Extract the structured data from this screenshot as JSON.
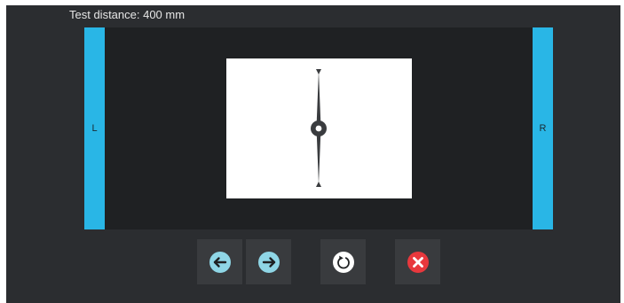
{
  "header": {
    "test_distance_text": "Test distance: 400 mm"
  },
  "side_bars": {
    "left_label": "L",
    "right_label": "R"
  },
  "controls": {
    "left_icon": "arrow-left-icon",
    "right_icon": "arrow-right-icon",
    "reset_icon": "reset-icon",
    "close_icon": "close-icon"
  },
  "colors": {
    "accent": "#29b6e6",
    "stage_bg": "#1f2123",
    "button_bg": "#393b3e",
    "arrow_circle": "#8fd6e6",
    "close_red": "#e8383d"
  }
}
